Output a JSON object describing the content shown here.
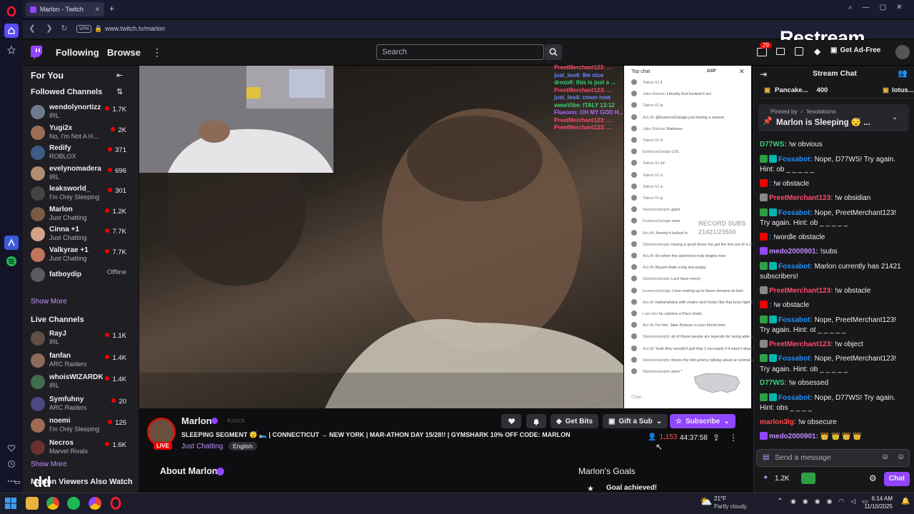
{
  "browser": {
    "tab_title": "Marlon - Twitch",
    "url": "www.twitch.tv/marlon",
    "vpn_badge": "VPN"
  },
  "topnav": {
    "following": "Following",
    "browse": "Browse",
    "search_placeholder": "Search",
    "notif_count": "29",
    "ad_free": "Get Ad-Free",
    "restream_watermark": "Restream"
  },
  "sidebar": {
    "for_you": "For You",
    "followed_title": "Followed Channels",
    "followed": [
      {
        "name": "wendolynortizz",
        "category": "IRL",
        "viewers": "1.7K",
        "color": "#6f7a8a"
      },
      {
        "name": "Yugi2x",
        "category": "No, I'm Not A H...",
        "viewers": "2K",
        "color": "#9a6e55"
      },
      {
        "name": "Redify",
        "category": "ROBLOX",
        "viewers": "371",
        "color": "#3f5b86"
      },
      {
        "name": "evelynomadera",
        "category": "IRL",
        "viewers": "696",
        "color": "#b38d6f"
      },
      {
        "name": "leaksworld_",
        "category": "I'm Only Sleeping",
        "viewers": "301",
        "color": "#444"
      },
      {
        "name": "Marlon",
        "category": "Just Chatting",
        "viewers": "1.2K",
        "color": "#7a5a45"
      },
      {
        "name": "Cinna +1",
        "category": "Just Chatting",
        "viewers": "7.7K",
        "color": "#d5a188"
      },
      {
        "name": "Valkyrae +1",
        "category": "Just Chatting",
        "viewers": "7.7K",
        "color": "#c1745e"
      },
      {
        "name": "fatboydip",
        "category": "",
        "viewers": "Offline",
        "color": "#5a5a60"
      }
    ],
    "show_more": "Show More",
    "live_title": "Live Channels",
    "live": [
      {
        "name": "RayJ",
        "category": "IRL",
        "viewers": "1.1K",
        "color": "#5f4f45"
      },
      {
        "name": "fanfan",
        "category": "ARC Raiders",
        "viewers": "1.4K",
        "color": "#8d6b5a"
      },
      {
        "name": "whoisWIZARDK...",
        "category": "IRL",
        "viewers": "1.4K",
        "color": "#3e6e4d"
      },
      {
        "name": "Symfuhny",
        "category": "ARC Raiders",
        "viewers": "20",
        "color": "#4a4a80"
      },
      {
        "name": "noemi",
        "category": "I'm Only Sleeping",
        "viewers": "125",
        "color": "#a06a55"
      },
      {
        "name": "Necros",
        "category": "Marvel Rivals",
        "viewers": "1.6K",
        "color": "#6b3030"
      }
    ],
    "show_more_2": "Show More",
    "also_watch": "Marlon Viewers Also Watch"
  },
  "overlay_chat": [
    {
      "text": "PreetMerchant123: ...",
      "color": "#ff4a6e"
    },
    {
      "text": "just_leo4: 8m nice",
      "color": "#6a8bff"
    },
    {
      "text": "drezoll: this is just a ...",
      "color": "#3fd17a"
    },
    {
      "text": "PreetMerchant123: ...",
      "color": "#ff4a6e"
    },
    {
      "text": "just_leo4: cmon now",
      "color": "#6a8bff"
    },
    {
      "text": "wwwVibe: ITALY 13:12",
      "color": "#3fd17a"
    },
    {
      "text": "Flueonn: OH MY GOD H...",
      "color": "#b06aff"
    },
    {
      "text": "PreetMerchant123: ...",
      "color": "#ff4a6e"
    },
    {
      "text": "PreetMerchant123: ...",
      "color": "#ff4a6e"
    }
  ],
  "popout": {
    "header": "Top chat",
    "badge": "GXP",
    "record_subs": "RECORD SUBS",
    "record_count": "21421/23500",
    "input_placeholder": "Chat...",
    "rows": [
      {
        "n": "Taikon 51",
        "t": "ll"
      },
      {
        "n": "Jake Robson",
        "t": "Literally foul hooked it too"
      },
      {
        "n": "Taikon 51",
        "t": "p"
      },
      {
        "n": "AxLr8r",
        "t": "@EssenceGarage just having a seizure"
      },
      {
        "n": "Jake Robson",
        "t": "Madness"
      },
      {
        "n": "Taikon 51",
        "t": "ñ"
      },
      {
        "n": "EssenceGarage",
        "t": "LOL"
      },
      {
        "n": "Taikon 51",
        "t": "lol"
      },
      {
        "n": "Taikon 51",
        "t": "o"
      },
      {
        "n": "Taikon 51",
        "t": "e"
      },
      {
        "n": "Taikon 51",
        "t": "p"
      },
      {
        "n": "Skeletonskeptic",
        "t": "giant"
      },
      {
        "n": "EssenceGarage",
        "t": "wow"
      },
      {
        "n": "AxLr8r",
        "t": "Jeremy's locked in"
      },
      {
        "n": "Skeletonskeptic",
        "t": "having a good driver too get the line out of a snag"
      },
      {
        "n": "AxLr8r",
        "t": "It's when the adventure truly begins moo"
      },
      {
        "n": "AxLr8r",
        "t": "Bayum thats a big sea puppy"
      },
      {
        "n": "Skeletonskeptic",
        "t": "Lord have mercy"
      },
      {
        "n": "EssenceGarage",
        "t": "I love waking up to these streams at 6am"
      },
      {
        "n": "AxLr8r",
        "t": "Hahahahaha with chains and hooks like that boss fight incoming"
      },
      {
        "n": "I am him",
        "t": "he catches a Paco shark"
      },
      {
        "n": "AxLr8r",
        "t": "I'm him, Jake Robson is your friend here"
      },
      {
        "n": "Skeletonskeptic",
        "t": "all of those people are legends for being able to fish the way they do"
      },
      {
        "n": "AxLr8r",
        "t": "Yeah they wouldn't pull that 1 out easily if it wasn't dead lol"
      },
      {
        "n": "Skeletonskeptic",
        "t": "theres the fish jeremy talking about an animal almost ne..."
      },
      {
        "n": "Skeletonskeptic",
        "t": "seen *"
      }
    ]
  },
  "stream": {
    "channel": "Marlon",
    "knock": "Knock",
    "title": "SLEEPING SEGMENT 😴 🛌 | CONNECTICUT → NEW YORK | MAR-ATHON DAY 15/28!! | GYMSHARK 10% OFF CODE: MARLON",
    "category": "Just Chatting",
    "tag": "English",
    "live": "LIVE",
    "viewers": "1,153",
    "uptime": "44:37:58",
    "get_bits": "Get Bits",
    "gift_sub": "Gift a Sub",
    "subscribe": "Subscribe",
    "about": "About Marlon",
    "goals": "Marlon's Goals",
    "goal_achieved": "Goal achieved!"
  },
  "chat": {
    "title": "Stream Chat",
    "leaderboard": [
      {
        "name": "Pancake...",
        "value": "400"
      },
      {
        "name": "lotus..."
      }
    ],
    "pinned_by": "Pinned by",
    "pinned_user": "fesolations",
    "pinned_text": "Marlon is Sleeping 😴 ...",
    "messages": [
      {
        "user": "D77WS",
        "color": "#3fd17a",
        "text": "!w obvious",
        "badges": []
      },
      {
        "user": "Fossabot",
        "color": "#1e90ff",
        "text": "Nope, D77WS! Try again. Hint: ob _ _ _ _ _",
        "badges": [
          "#2ea043",
          "#00b5ad"
        ]
      },
      {
        "user": "",
        "color": "#4466ff",
        "text": "!w obstacle",
        "badges": [
          "#eb0400"
        ]
      },
      {
        "user": "PreetMerchant123",
        "color": "#ff4a6e",
        "text": "!w obsidian",
        "badges": [
          "#888"
        ]
      },
      {
        "user": "Fossabot",
        "color": "#1e90ff",
        "text": "Nope, PreetMerchant123! Try again. Hint: ob _ _ _ _ _",
        "badges": [
          "#2ea043",
          "#00b5ad"
        ]
      },
      {
        "user": "",
        "color": "#4466ff",
        "text": "!wordle obstacle",
        "badges": [
          "#eb0400"
        ]
      },
      {
        "user": "medo2000901",
        "color": "#c08aff",
        "text": "!subs",
        "badges": [
          "#9146ff"
        ]
      },
      {
        "user": "Fossabot",
        "color": "#1e90ff",
        "text": "Marlon currently has 21421 subscribers!",
        "badges": [
          "#2ea043",
          "#00b5ad"
        ]
      },
      {
        "user": "PreetMerchant123",
        "color": "#ff4a6e",
        "text": "!w obstacle",
        "badges": [
          "#888"
        ]
      },
      {
        "user": "",
        "color": "#4466ff",
        "text": "!w obstacle",
        "badges": [
          "#eb0400"
        ]
      },
      {
        "user": "Fossabot",
        "color": "#1e90ff",
        "text": "Nope, PreetMerchant123! Try again. Hint: ot _ _ _ _ _",
        "badges": [
          "#2ea043",
          "#00b5ad"
        ]
      },
      {
        "user": "PreetMerchant123",
        "color": "#ff4a6e",
        "text": "!w object",
        "badges": [
          "#888"
        ]
      },
      {
        "user": "Fossabot",
        "color": "#1e90ff",
        "text": "Nope, PreetMerchant123! Try again. Hint: ob _ _ _ _ _",
        "badges": [
          "#2ea043",
          "#00b5ad"
        ]
      },
      {
        "user": "D77WS",
        "color": "#3fd17a",
        "text": "!w obsessed",
        "badges": []
      },
      {
        "user": "Fossabot",
        "color": "#1e90ff",
        "text": "Nope, D77WS! Try again. Hint: obs _ _ _ _",
        "badges": [
          "#2ea043",
          "#00b5ad"
        ]
      },
      {
        "user": "marlon3lg",
        "color": "#ff4a4a",
        "text": "!w obsecure",
        "badges": []
      },
      {
        "user": "medo2000901",
        "color": "#c08aff",
        "text": "👑 👑 👑 👑",
        "badges": [
          "#9146ff"
        ]
      }
    ],
    "input_placeholder": "Send a message",
    "points": "1.2K",
    "chat_button": "Chat"
  },
  "taskbar": {
    "weather_temp": "21°F",
    "weather_desc": "Partly cloudy",
    "time": "6:14 AM",
    "date": "11/10/2025",
    "dd": "dd"
  },
  "colors": {
    "twitch_purple": "#9146ff",
    "live_red": "#eb0400"
  }
}
